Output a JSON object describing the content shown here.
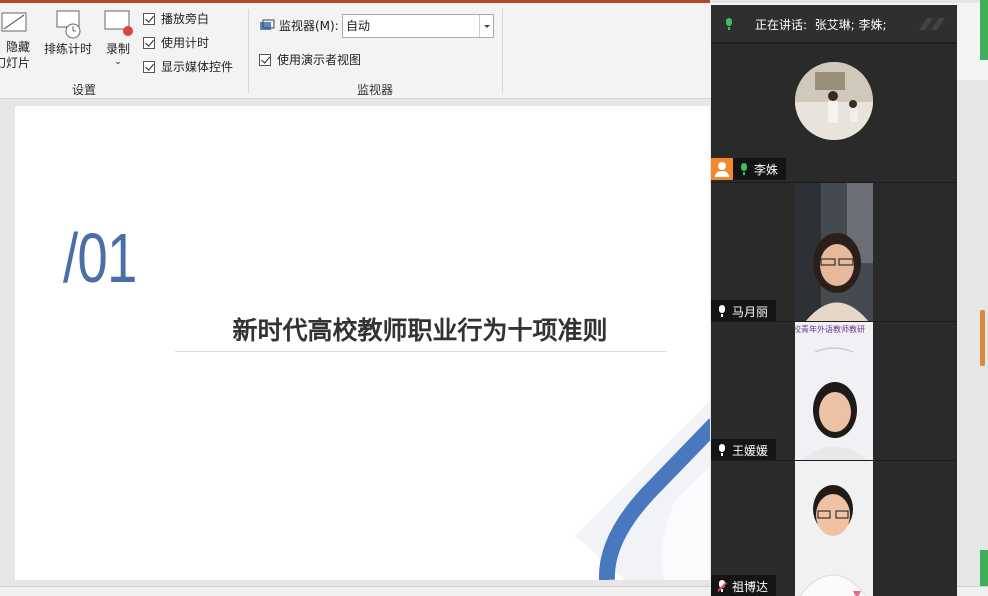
{
  "ribbon": {
    "hide_slide_label_1": "隐藏",
    "hide_slide_label_2": "幻灯片",
    "rehearse_label": "排练计时",
    "record_label": "录制",
    "checkboxes": {
      "narration": "播放旁白",
      "timings": "使用计时",
      "media_controls": "显示媒体控件"
    },
    "group_setup": "设置",
    "monitor_label": "监视器(M):",
    "monitor_value": "自动",
    "presenter_view": "使用演示者视图",
    "group_monitors": "监视器"
  },
  "slide": {
    "number": "/01",
    "title": "新时代高校教师职业行为十项准则"
  },
  "meeting": {
    "speaking_label": "正在讲话:",
    "speaking_names": "张艾琳; 李姝;",
    "participants": [
      {
        "name": "李姝"
      },
      {
        "name": "马月丽"
      },
      {
        "name": "王媛媛",
        "banner_text": "校青年外语教师教研"
      },
      {
        "name": "祖博达"
      }
    ]
  },
  "colors": {
    "accent": "#b7472a",
    "slide_blue": "#4a6fa8",
    "mic_green": "#3fbf5a",
    "avatar_orange": "#f0892e"
  }
}
